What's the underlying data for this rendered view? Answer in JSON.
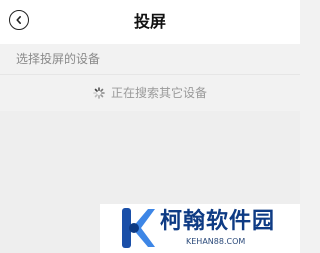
{
  "header": {
    "title": "投屏",
    "back_icon": "chevron-left-icon"
  },
  "section": {
    "label": "选择投屏的设备"
  },
  "search_status": {
    "icon": "spinner-icon",
    "text": "正在搜索其它设备"
  },
  "watermark": {
    "name": "柯翰软件园",
    "domain": "KEHAN88.COM",
    "brand_color": "#0e3b84"
  }
}
